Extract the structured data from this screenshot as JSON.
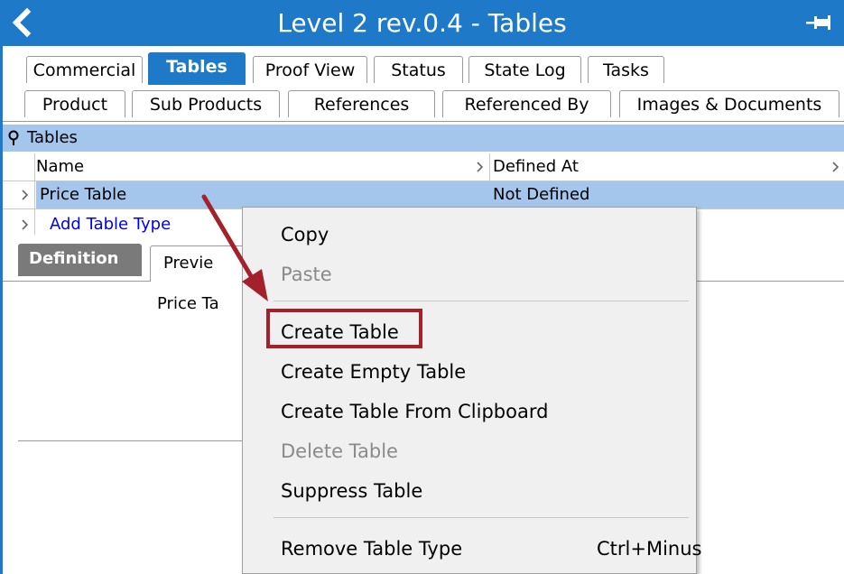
{
  "titlebar": {
    "title": "Level 2 rev.0.4 - Tables"
  },
  "tabs_row1": [
    {
      "label": "Commercial"
    },
    {
      "label": "Tables",
      "active": true
    },
    {
      "label": "Proof View"
    },
    {
      "label": "Status"
    },
    {
      "label": "State Log"
    },
    {
      "label": "Tasks"
    }
  ],
  "tabs_row2": [
    {
      "label": "Product"
    },
    {
      "label": "Sub Products"
    },
    {
      "label": "References"
    },
    {
      "label": "Referenced By"
    },
    {
      "label": "Images & Documents"
    }
  ],
  "tables_panel": {
    "header": "Tables",
    "columns": [
      "Name",
      "Defined At"
    ],
    "rows": [
      {
        "name": "Price Table",
        "defined_at": "Not Defined"
      }
    ],
    "add_link": "Add Table Type"
  },
  "subtabs": [
    {
      "label": "Definition",
      "active": true
    },
    {
      "label": "Previe"
    }
  ],
  "content": {
    "label": "Price Ta"
  },
  "context_menu": {
    "items": {
      "copy": "Copy",
      "paste": "Paste",
      "create_table": "Create Table",
      "create_empty_table": "Create Empty Table",
      "create_from_clipboard": "Create Table From Clipboard",
      "delete_table": "Delete Table",
      "suppress_table": "Suppress Table",
      "remove_table_type": "Remove Table Type",
      "remove_shortcut": "Ctrl+Minus"
    }
  },
  "colors": {
    "title_bar": "#1e7ac9",
    "selection": "#a4c6ec",
    "annotation": "#a3212b",
    "link": "#0000ee"
  }
}
